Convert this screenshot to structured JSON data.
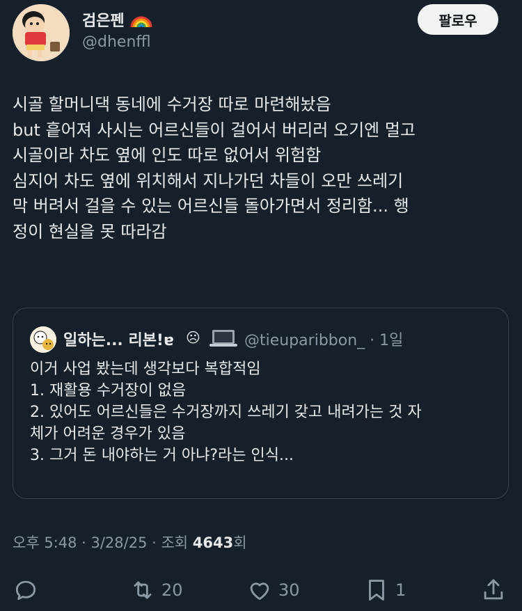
{
  "author": {
    "display_name": "검은펜",
    "handle": "@dhenffl"
  },
  "follow_button": {
    "label": "팔로우"
  },
  "tweet": {
    "lines": [
      "시골 할머니댁 동네에 수거장 따로 마련해놨음",
      "but 흩어져 사시는 어르신들이 걸어서 버리러 오기엔 멀고",
      "시골이라 차도 옆에 인도 따로 없어서 위험함",
      "심지어 차도 옆에 위치해서 지나가던 차들이 오만 쓰레기",
      "막 버려서 걸을 수 있는 어르신들 돌아가면서 정리함... 행",
      "정이 현실을 못 따라감"
    ]
  },
  "quote": {
    "display_name": "일하는... 리본!ɐ",
    "face_emoji": "☹",
    "handle": "@tieuparibbon_ · 1일",
    "lines": [
      "이거 사업 봤는데 생각보다 복합적임",
      "1. 재활용 수거장이 없음",
      "2. 있어도 어르신들은 수거장까지 쓰레기 갖고 내려가는 것 자",
      "체가 어려운 경우가 있음",
      "3. 그거 돈 내야하는 거 아냐?라는 인식..."
    ]
  },
  "meta": {
    "time": "오후 5:48 · 3/28/25 · 조회 ",
    "views": "4643",
    "views_suffix": "회"
  },
  "actions": {
    "reply_icon": "reply-icon",
    "retweet_count": "20",
    "like_count": "30",
    "bookmark_count": "1",
    "share_icon": "share-icon"
  },
  "colors": {
    "background": "#15202b",
    "text": "#e7e9ea",
    "secondary": "#8b98a5",
    "border": "#38444d"
  }
}
